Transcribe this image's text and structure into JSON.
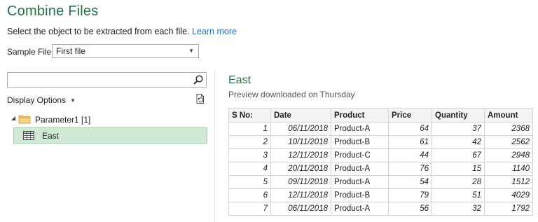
{
  "dialog": {
    "title": "Combine Files",
    "subtitle": "Select the object to be extracted from each file.",
    "learn_more": "Learn more"
  },
  "sample_file": {
    "label": "Sample File:",
    "value": "First file"
  },
  "navigator": {
    "search_value": "",
    "display_options": "Display Options",
    "tree": {
      "root": "Parameter1 [1]",
      "items": [
        {
          "label": "East",
          "selected": true
        }
      ]
    },
    "icons": {
      "search": "search-icon",
      "refresh": "refresh-icon",
      "folder": "folder-icon",
      "table": "table-icon"
    }
  },
  "preview": {
    "title": "East",
    "subtitle": "Preview downloaded on Thursday",
    "columns": [
      "S No:",
      "Date",
      "Product",
      "Price",
      "Quantity",
      "Amount"
    ],
    "rows": [
      [
        "1",
        "06/11/2018",
        "Product-A",
        "64",
        "37",
        "2368"
      ],
      [
        "2",
        "10/11/2018",
        "Product-B",
        "61",
        "42",
        "2562"
      ],
      [
        "3",
        "12/11/2018",
        "Product-C",
        "44",
        "67",
        "2948"
      ],
      [
        "4",
        "20/11/2018",
        "Product-A",
        "76",
        "15",
        "1140"
      ],
      [
        "5",
        "09/11/2018",
        "Product-A",
        "54",
        "28",
        "1512"
      ],
      [
        "6",
        "12/11/2018",
        "Product-B",
        "79",
        "51",
        "4029"
      ],
      [
        "7",
        "06/11/2018",
        "Product-A",
        "56",
        "32",
        "1792"
      ]
    ]
  },
  "colors": {
    "accent": "#217346",
    "link": "#1f6fc5",
    "selected_bg": "#cfe9d4"
  }
}
